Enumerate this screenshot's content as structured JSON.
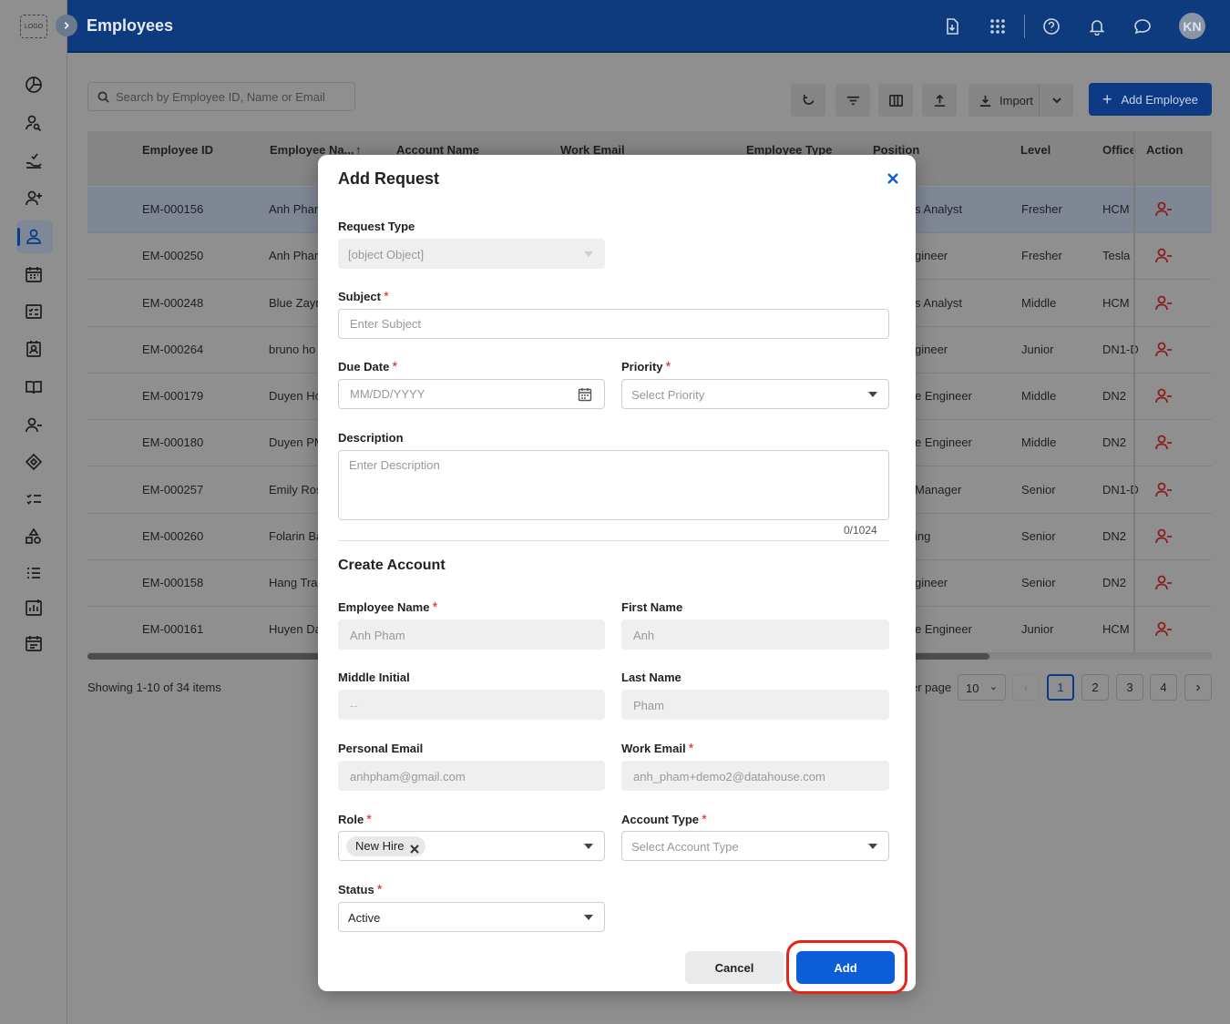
{
  "app": {
    "logo_text": "LOGO",
    "page_title": "Employees",
    "avatar_initials": "KN"
  },
  "sidebar": {
    "icons": [
      "dashboard-icon",
      "user-search-icon",
      "hand-check-icon",
      "user-plus-icon",
      "user-icon",
      "calendar-icon",
      "checklist-icon",
      "id-card-icon",
      "book-icon",
      "user-minus-icon",
      "tag-icon",
      "task-list-icon",
      "shapes-icon",
      "list-icon",
      "chart-icon",
      "schedule-icon"
    ],
    "active_item": "user-icon"
  },
  "header": {
    "icons": [
      "download-file-icon",
      "apps-grid-icon",
      "help-icon",
      "bell-icon",
      "chat-icon"
    ]
  },
  "toolbar": {
    "search_placeholder": "Search by Employee ID, Name or Email",
    "import_label": "Import",
    "add_employee_label": "Add Employee",
    "add_employee_icon": "+"
  },
  "table": {
    "columns": [
      "Employee ID",
      "Employee Na...",
      "Account Name",
      "Work Email",
      "Employee Type",
      "Position",
      "Level",
      "Office",
      "Action"
    ],
    "rows": [
      {
        "id": "EM-000156",
        "name": "Anh Pham",
        "position": "s Analyst",
        "level": "Fresher",
        "office": "HCM"
      },
      {
        "id": "EM-000250",
        "name": "Anh Pham",
        "position": "gineer",
        "level": "Fresher",
        "office": "Tesla"
      },
      {
        "id": "EM-000248",
        "name": "Blue Zayn",
        "position": "s Analyst",
        "level": "Middle",
        "office": "HCM"
      },
      {
        "id": "EM-000264",
        "name": "bruno ho",
        "position": "gineer",
        "level": "Junior",
        "office": "DN1-D"
      },
      {
        "id": "EM-000179",
        "name": "Duyen Ho",
        "position": "e Engineer",
        "level": "Middle",
        "office": "DN2"
      },
      {
        "id": "EM-000180",
        "name": "Duyen PM",
        "position": "e Engineer",
        "level": "Middle",
        "office": "DN2"
      },
      {
        "id": "EM-000257",
        "name": "Emily Ros",
        "position": "Manager",
        "level": "Senior",
        "office": "DN1-D"
      },
      {
        "id": "EM-000260",
        "name": "Folarin Ba",
        "position": "ing",
        "level": "Senior",
        "office": "DN2"
      },
      {
        "id": "EM-000158",
        "name": "Hang Trar",
        "position": "gineer",
        "level": "Senior",
        "office": "DN2"
      },
      {
        "id": "EM-000161",
        "name": "Huyen Da",
        "position": "e Engineer",
        "level": "Junior",
        "office": "HCM"
      }
    ],
    "selected_row": 0
  },
  "pagination": {
    "showing": "Showing 1-10 of 34 items",
    "per_page_label": "er page",
    "per_page_value": "10",
    "pages": [
      "1",
      "2",
      "3",
      "4"
    ],
    "current_page": "1"
  },
  "modal": {
    "title": "Add Request",
    "request_type": {
      "label": "Request Type",
      "value": "[object Object]"
    },
    "subject": {
      "label": "Subject",
      "placeholder": "Enter Subject"
    },
    "due_date": {
      "label": "Due Date",
      "placeholder": "MM/DD/YYYY"
    },
    "priority": {
      "label": "Priority",
      "placeholder": "Select Priority"
    },
    "description": {
      "label": "Description",
      "placeholder": "Enter Description",
      "counter": "0/1024"
    },
    "create_account": {
      "title": "Create Account",
      "employee_name": {
        "label": "Employee Name",
        "value": "Anh Pham"
      },
      "first_name": {
        "label": "First Name",
        "value": "Anh"
      },
      "middle_initial": {
        "label": "Middle Initial",
        "value": "--"
      },
      "last_name": {
        "label": "Last Name",
        "value": "Pham"
      },
      "personal_email": {
        "label": "Personal Email",
        "value": "anhpham@gmail.com"
      },
      "work_email": {
        "label": "Work Email",
        "value": "anh_pham+demo2@datahouse.com"
      },
      "role": {
        "label": "Role",
        "chip": "New Hire"
      },
      "account_type": {
        "label": "Account Type",
        "placeholder": "Select Account Type"
      },
      "status": {
        "label": "Status",
        "value": "Active"
      }
    },
    "required_mark": "*",
    "cancel_label": "Cancel",
    "add_label": "Add"
  },
  "colors": {
    "header_bg": "#0e3a7e",
    "primary": "#0b5ed7",
    "required": "#e02424",
    "highlight": "#e8231a"
  }
}
